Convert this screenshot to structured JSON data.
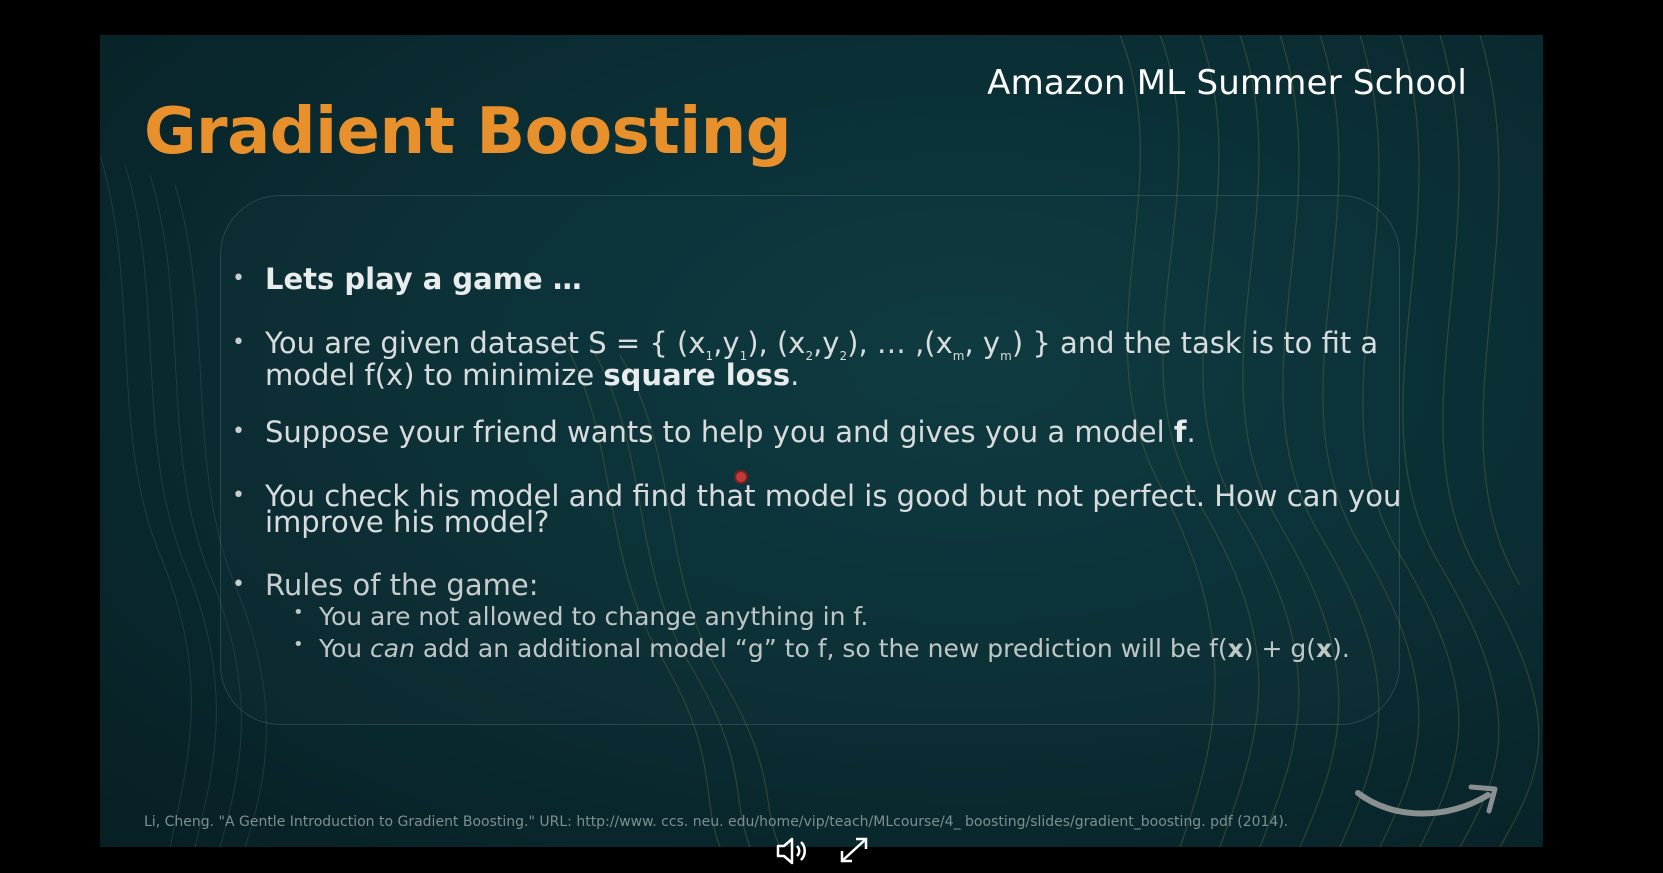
{
  "slide": {
    "brand": "Amazon ML Summer School",
    "title": "Gradient Boosting",
    "bullets": {
      "b1": "Lets play a game …",
      "b2_line1_a": "You are given dataset S = { (x",
      "b2_line1_sub1": "1",
      "b2_line1_b": ",y",
      "b2_line1_sub2": "1",
      "b2_line1_c": "), (x",
      "b2_line1_sub3": "2",
      "b2_line1_d": ",y",
      "b2_line1_sub4": "2",
      "b2_line1_e": "), … ,(x",
      "b2_line1_sub5": "m",
      "b2_line1_f": ", y",
      "b2_line1_sub6": "m",
      "b2_line1_g": ") } and the task is to fit a",
      "b2_line2_a": "model f(x) to minimize ",
      "b2_line2_bold": "square loss",
      "b2_line2_b": ".",
      "b3_a": "Suppose your friend wants to help you and gives you a model ",
      "b3_bold": "f",
      "b3_b": ".",
      "b4_line1": "You check his model and find that model is good but not perfect. How can you",
      "b4_line2": "improve his model?",
      "b5": "Rules of the game:",
      "sub1": "You are not allowed to change anything in f.",
      "sub2_a": "You ",
      "sub2_italic": "can",
      "sub2_b": " add an additional model “g” to f, so the new prediction will be f(",
      "sub2_x1": "x",
      "sub2_c": ") + g(",
      "sub2_x2": "x",
      "sub2_d": ")."
    },
    "citation": "Li, Cheng. \"A Gentle Introduction to Gradient Boosting.\" URL: http://www. ccs. neu. edu/home/vip/teach/MLcourse/4_ boosting/slides/gradient_boosting. pdf (2014)."
  },
  "controls": {
    "volume_icon": "volume-icon",
    "fullscreen_icon": "fullscreen-icon"
  },
  "colors": {
    "title": "#e8902c",
    "background": "#0a2f35",
    "text": "#d8dcdc"
  }
}
